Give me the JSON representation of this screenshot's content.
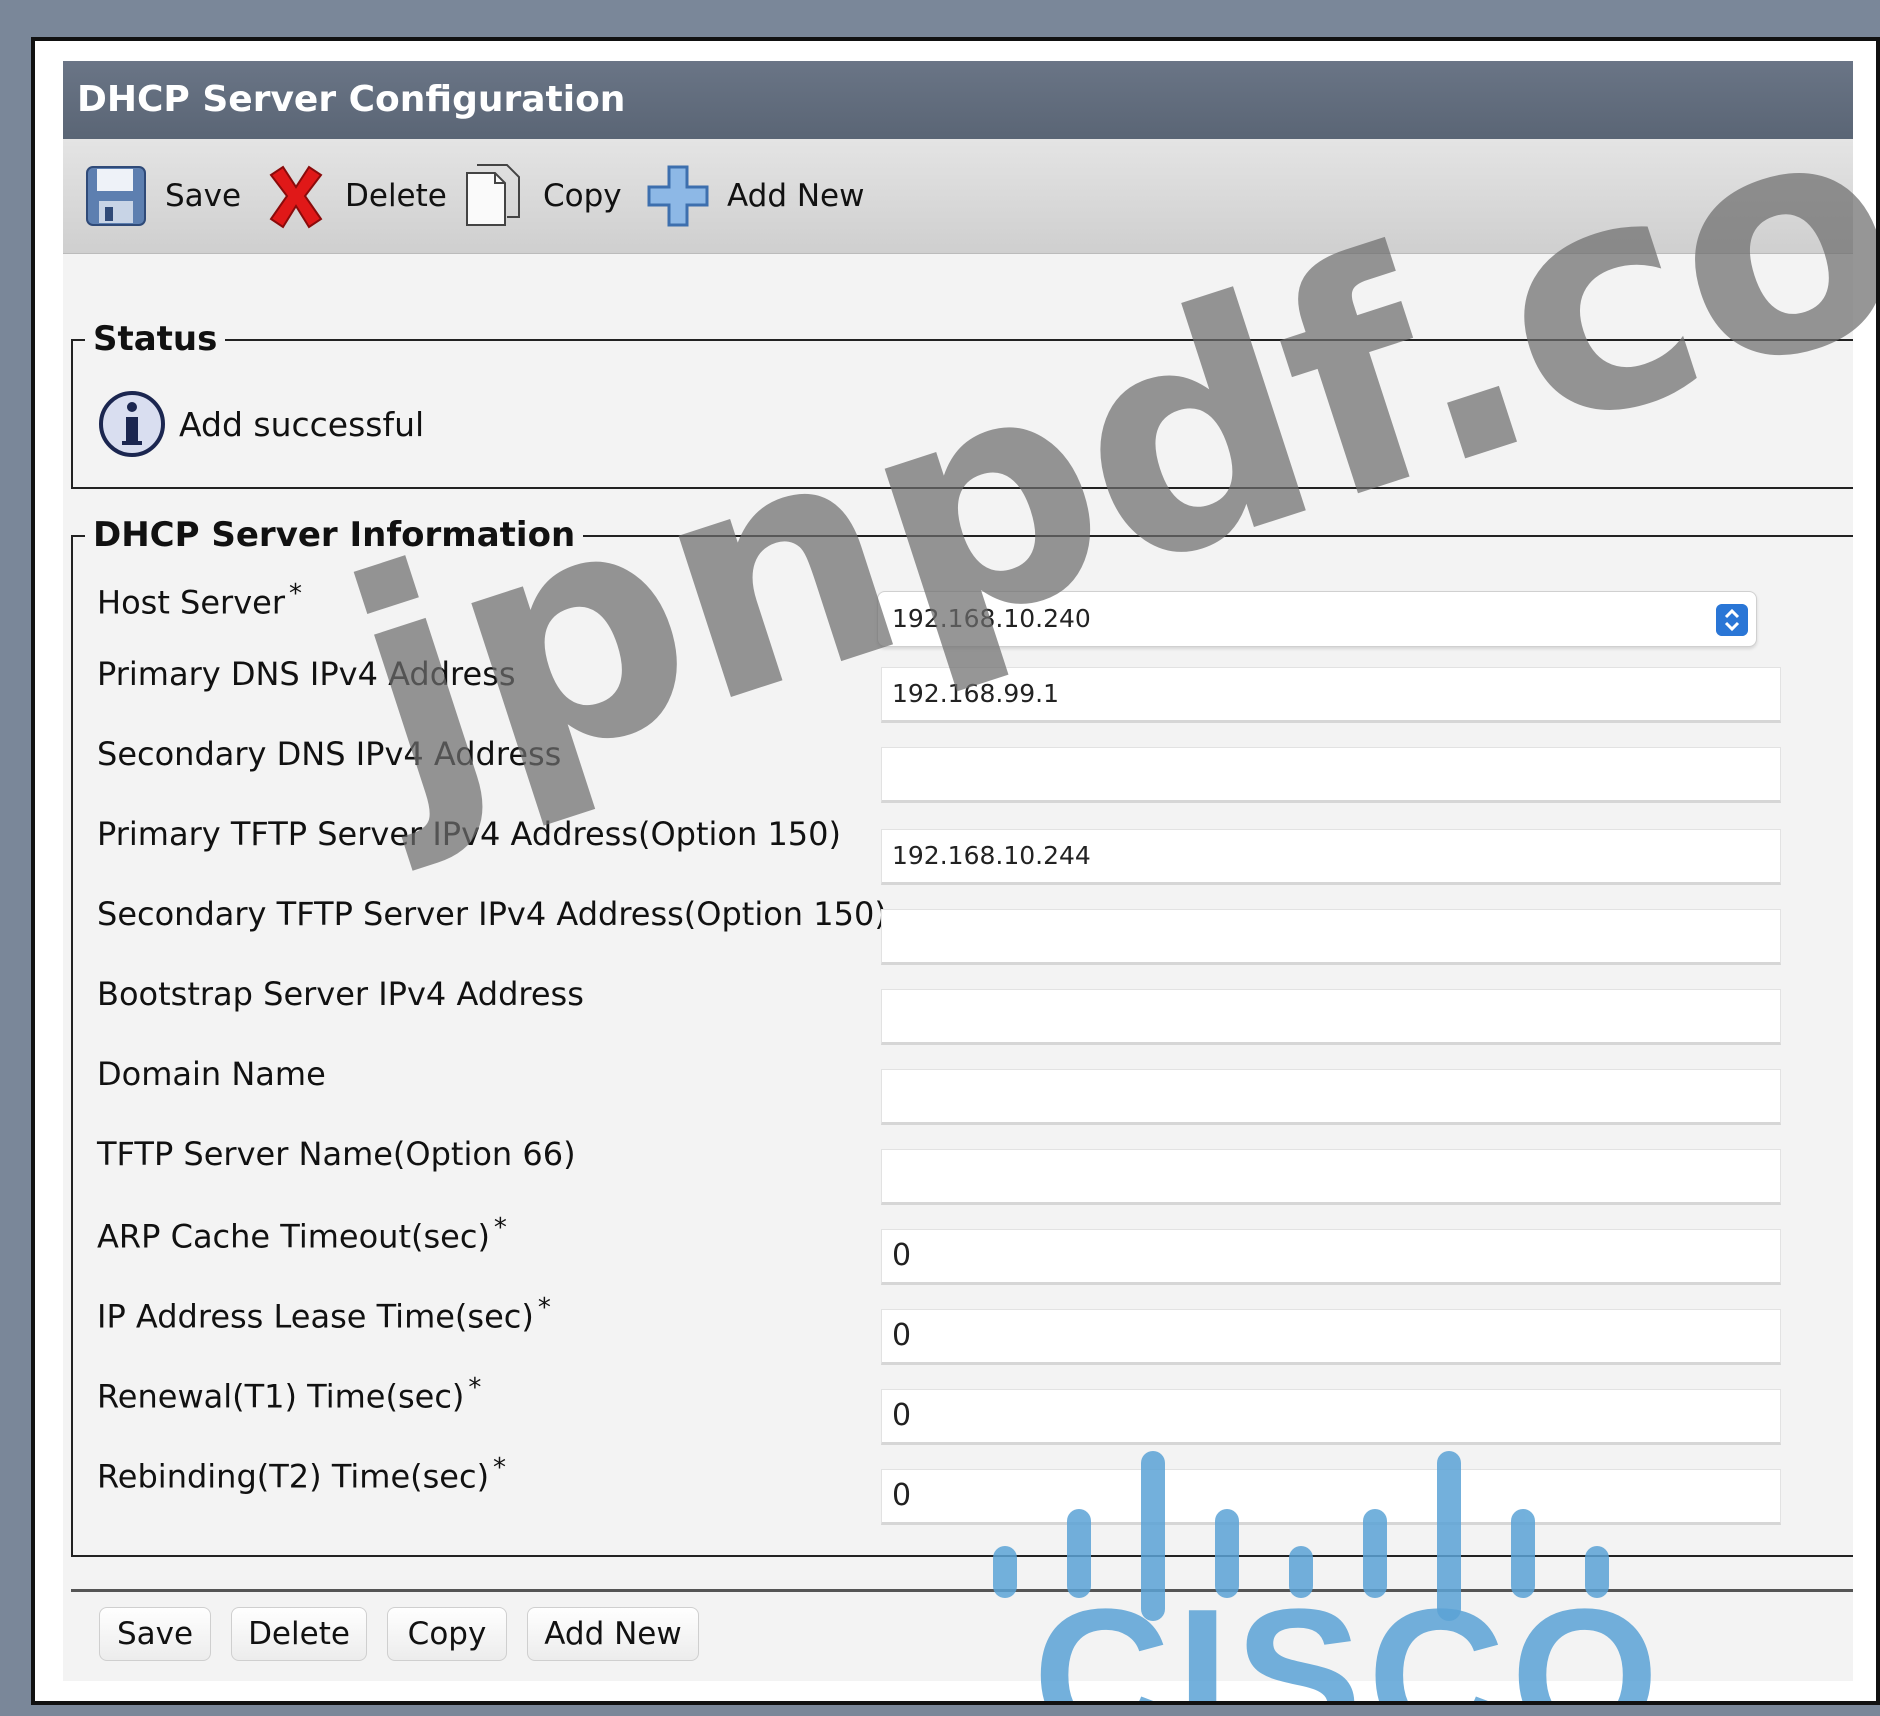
{
  "title": "DHCP Server Configuration",
  "toolbar": {
    "save": "Save",
    "delete": "Delete",
    "copy": "Copy",
    "add_new": "Add New"
  },
  "status": {
    "legend": "Status",
    "message": "Add successful"
  },
  "info": {
    "legend": "DHCP Server Information",
    "fields": [
      {
        "label": "Host Server",
        "required": "*",
        "value": "192.168.10.240"
      },
      {
        "label": "Primary DNS IPv4 Address",
        "value": "192.168.99.1"
      },
      {
        "label": "Secondary DNS IPv4 Address",
        "value": ""
      },
      {
        "label": "Primary TFTP Server IPv4 Address(Option 150)",
        "value": "192.168.10.244"
      },
      {
        "label": "Secondary TFTP Server IPv4 Address(Option 150)",
        "value": ""
      },
      {
        "label": "Bootstrap Server IPv4 Address",
        "value": ""
      },
      {
        "label": "Domain Name",
        "value": ""
      },
      {
        "label": "TFTP Server Name(Option 66)",
        "value": ""
      },
      {
        "label": "ARP Cache Timeout(sec)",
        "required": "*",
        "value": "0"
      },
      {
        "label": "IP Address Lease Time(sec)",
        "required": "*",
        "value": "0"
      },
      {
        "label": "Renewal(T1) Time(sec)",
        "required": "*",
        "value": "0"
      },
      {
        "label": "Rebinding(T2) Time(sec)",
        "required": "*",
        "value": "0"
      }
    ]
  },
  "buttons": {
    "save": "Save",
    "delete": "Delete",
    "copy": "Copy",
    "add_new": "Add New"
  },
  "watermark": {
    "text": "jpnpdf.com",
    "brand": "CISCO"
  },
  "colors": {
    "titlebar": "#5f6a7a",
    "delete_icon": "#e01818",
    "add_icon": "#5b9bd8",
    "cisco_blue": "#5ba3d6"
  }
}
